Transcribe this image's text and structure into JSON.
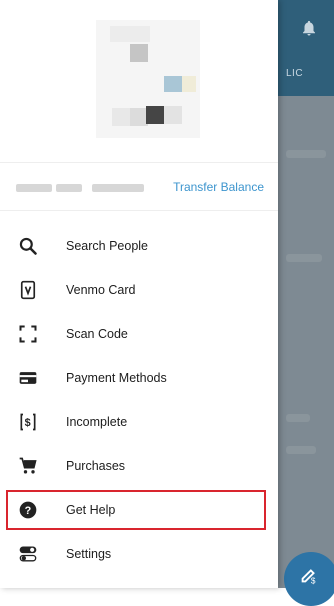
{
  "background": {
    "tab_label": "LIC",
    "header_color": "#2f5f7a",
    "fab_color": "#2d74a6"
  },
  "drawer": {
    "transfer_label": "Transfer Balance",
    "accent_color": "#3d95ce",
    "highlight_color": "#d9252e",
    "menu": [
      {
        "label": "Search People",
        "icon": "search-icon"
      },
      {
        "label": "Venmo Card",
        "icon": "venmo-card-icon"
      },
      {
        "label": "Scan Code",
        "icon": "scan-code-icon"
      },
      {
        "label": "Payment Methods",
        "icon": "credit-card-icon"
      },
      {
        "label": "Incomplete",
        "icon": "incomplete-dollar-icon"
      },
      {
        "label": "Purchases",
        "icon": "cart-icon"
      },
      {
        "label": "Get Help",
        "icon": "help-icon"
      },
      {
        "label": "Settings",
        "icon": "settings-toggle-icon"
      }
    ]
  }
}
